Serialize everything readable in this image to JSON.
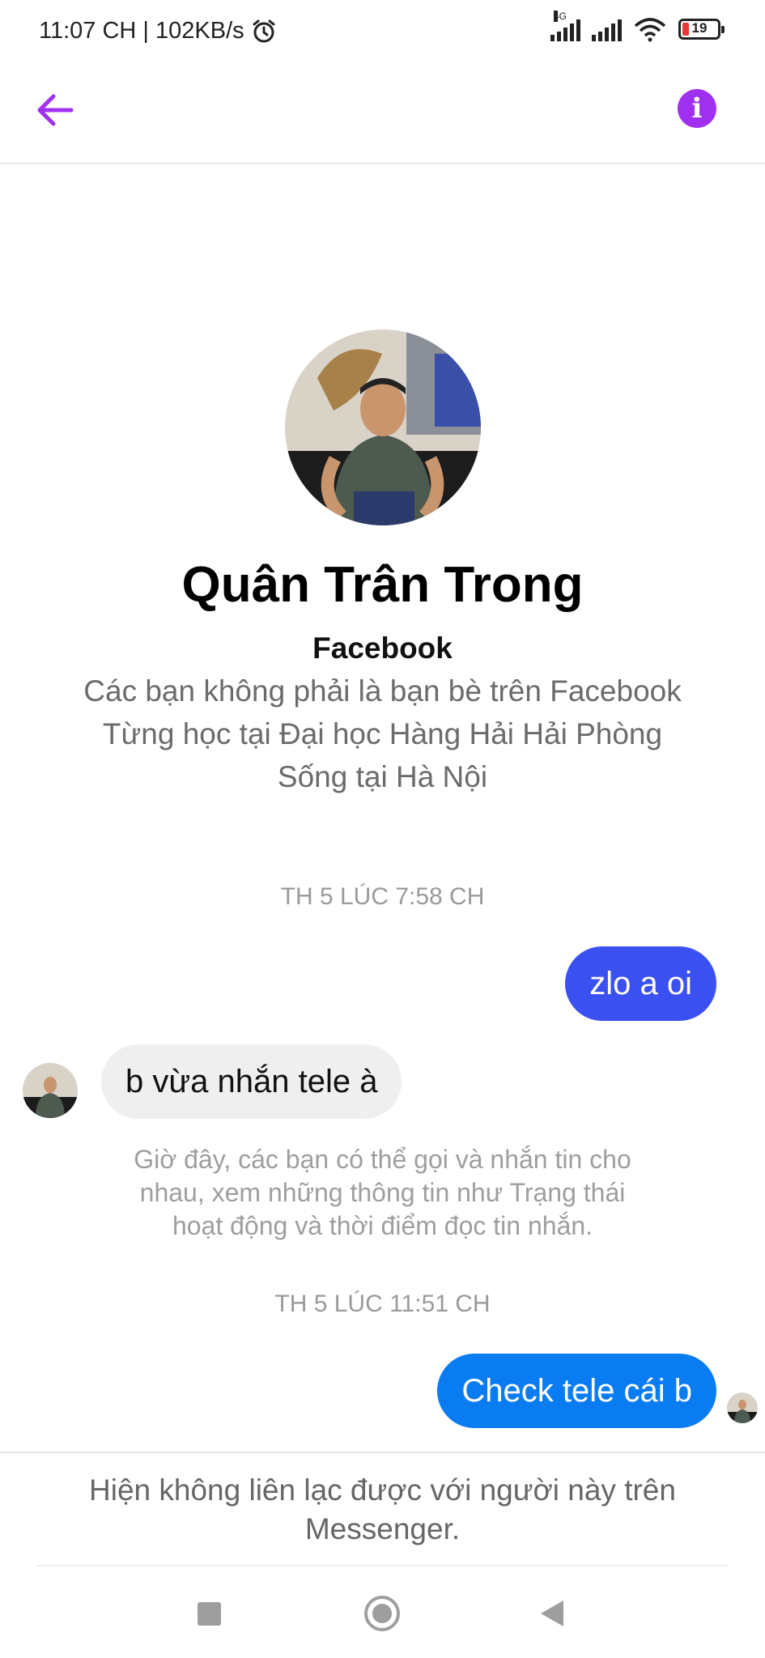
{
  "status_bar": {
    "time_speed": "11:07 CH | 102KB/s",
    "network_type": "4G",
    "battery_level": "19",
    "battery_fraction": 0.19,
    "icons": [
      "alarm-icon",
      "signal-icon",
      "signal-icon",
      "wifi-icon",
      "battery-icon"
    ]
  },
  "header": {
    "back_icon": "arrow-left-icon",
    "info_icon": "info-icon",
    "info_glyph": "i",
    "accent_color": "#a030f0"
  },
  "profile": {
    "name": "Quân Trân Trong",
    "source": "Facebook",
    "line1": "Các bạn không phải là bạn bè trên Facebook",
    "line2": "Từng học tại Đại học Hàng Hải Hải Phòng",
    "line3": "Sống tại Hà Nội"
  },
  "messages": {
    "timestamp1": "TH 5 LÚC 7:58 CH",
    "outgoing1": "zlo a oi",
    "incoming1": "b vừa nhắn tele à",
    "notice": "Giờ đây, các bạn có thể gọi và nhắn tin cho nhau, xem những thông tin như Trạng thái hoạt động và thời điểm đọc tin nhắn.",
    "timestamp2": "TH 5 LÚC 11:51 CH",
    "outgoing2": "Check tele cái b",
    "bubble_colors": {
      "outgoing1": "#3b50f0",
      "outgoing2": "#0a7cf2",
      "incoming": "#efefef"
    }
  },
  "footer": {
    "unavailable_message": "Hiện không liên lạc được với người này trên Messenger."
  },
  "nav_bar": {
    "icons": [
      "recent-apps-icon",
      "home-icon",
      "back-icon"
    ]
  }
}
